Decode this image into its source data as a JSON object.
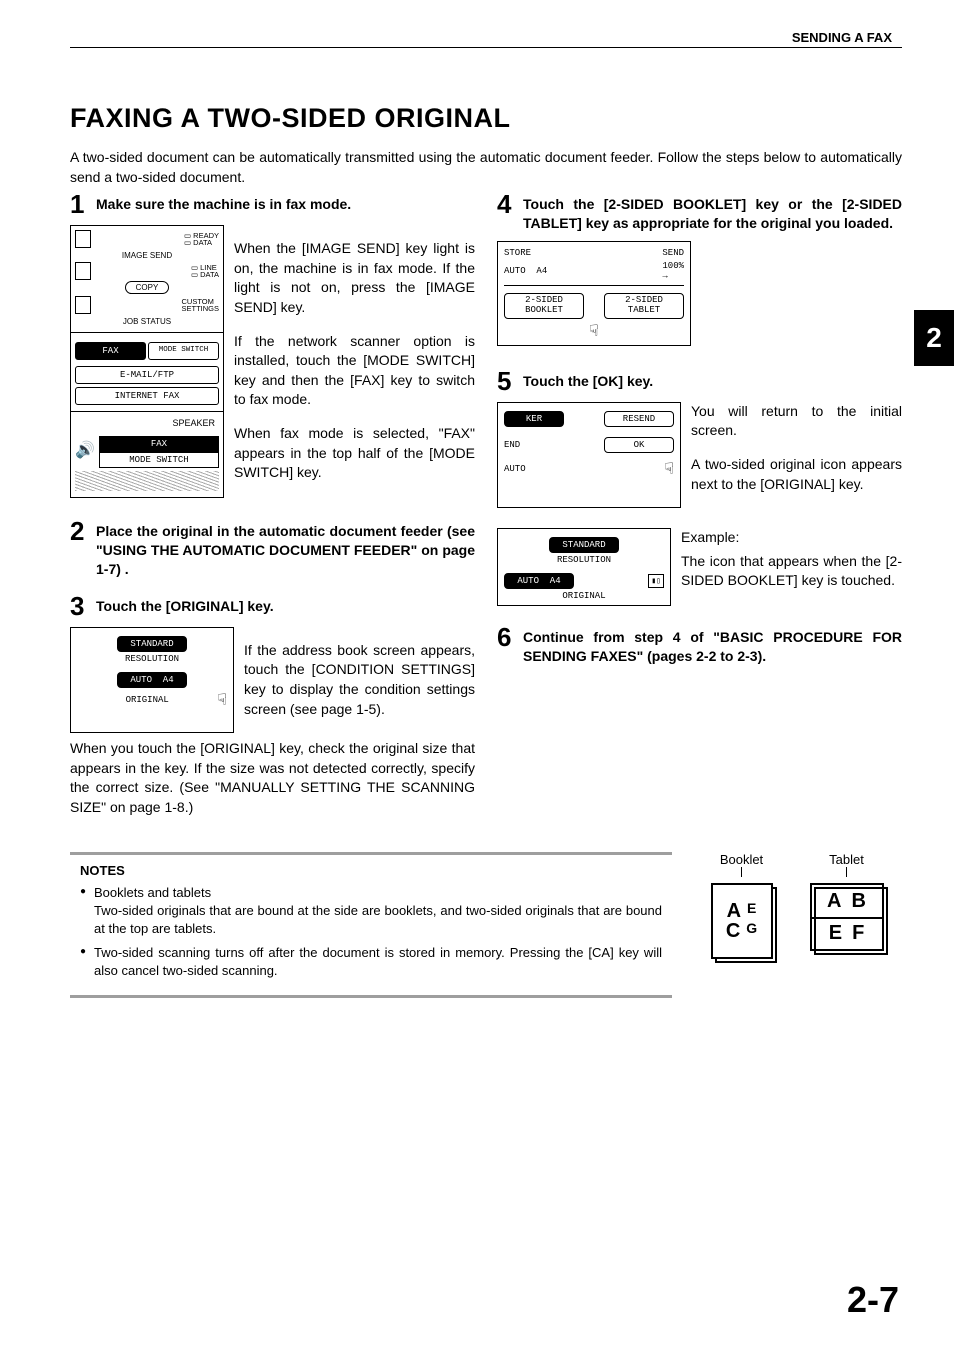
{
  "header": {
    "section": "SENDING A FAX"
  },
  "title": "FAXING A TWO-SIDED ORIGINAL",
  "intro": "A two-sided document can be automatically transmitted using the automatic document feeder. Follow the steps below to automatically send a two-sided document.",
  "chapter_tab": "2",
  "page_number": "2-7",
  "steps": {
    "s1": {
      "num": "1",
      "title": "Make sure the machine is in fax mode.",
      "p1": "When the [IMAGE SEND] key light is on, the machine is in fax mode. If the light is not on, press the [IMAGE SEND] key.",
      "p2": "If the network scanner option is installed, touch the [MODE SWITCH] key and then the [FAX] key to switch to fax mode.",
      "p3": "When fax mode is selected, \"FAX\" appears in the top half of the [MODE SWITCH] key."
    },
    "s2": {
      "num": "2",
      "title": "Place the original in the automatic document feeder (see \"USING THE AUTOMATIC DOCUMENT FEEDER\" on page 1-7) ."
    },
    "s3": {
      "num": "3",
      "title": "Touch the [ORIGINAL] key.",
      "p1": "If the address book screen appears, touch the [CONDITION SETTINGS] key to display the condition settings screen (see page 1-5).",
      "p2": "When you touch the [ORIGINAL] key, check the original size that appears in the key. If the size was not detected correctly, specify the correct size. (See \"MANUALLY SETTING THE SCANNING SIZE\" on page 1-8.)"
    },
    "s4": {
      "num": "4",
      "title": "Touch the [2-SIDED BOOKLET] key or the [2-SIDED TABLET] key as appropriate for the original you loaded."
    },
    "s5": {
      "num": "5",
      "title": "Touch the [OK] key.",
      "p1": "You will return to the initial screen.",
      "p2": "A two-sided original icon appears next to the [ORIGINAL] key.",
      "ex_label": "Example:",
      "ex_text": "The icon that appears when the [2-SIDED BOOKLET] key is touched."
    },
    "s6": {
      "num": "6",
      "title": "Continue from step 4 of \"BASIC PROCEDURE FOR SENDING FAXES\" (pages 2-2 to 2-3)."
    }
  },
  "panel": {
    "ready": "READY",
    "data1": "DATA",
    "image_send": "IMAGE SEND",
    "line": "LINE",
    "data2": "DATA",
    "copy": "COPY",
    "job_status": "JOB STATUS",
    "custom": "CUSTOM\nSETTINGS",
    "fax": "FAX",
    "mode_switch_btn": "MODE SWITCH",
    "email": "E-MAIL/FTP",
    "inet": "INTERNET FAX",
    "speaker": "SPEAKER",
    "fax2": "FAX",
    "mode_switch2": "MODE SWITCH"
  },
  "screen3": {
    "standard": "STANDARD",
    "resolution": "RESOLUTION",
    "auto": "AUTO",
    "a4": "A4",
    "original": "ORIGINAL"
  },
  "screen4": {
    "store": "STORE",
    "send": "SEND",
    "auto": "AUTO",
    "a4": "A4",
    "pct": "100%",
    "booklet": "2-SIDED\nBOOKLET",
    "tablet": "2-SIDED\nTABLET"
  },
  "screen5a": {
    "ker": "KER",
    "resend": "RESEND",
    "end": "END",
    "ok": "OK",
    "auto": "AUTO"
  },
  "screen5b": {
    "standard": "STANDARD",
    "resolution": "RESOLUTION",
    "auto": "AUTO",
    "a4": "A4",
    "original": "ORIGINAL"
  },
  "notes": {
    "heading": "NOTES",
    "n1_title": "Booklets and tablets",
    "n1_body": "Two-sided originals that are bound at the side are booklets, and two-sided originals that are bound at the top are tablets.",
    "n2": "Two-sided scanning turns off after the document is stored in memory. Pressing the [CA] key will also cancel two-sided scanning."
  },
  "bt": {
    "booklet": "Booklet",
    "tablet": "Tablet",
    "A": "A",
    "B": "B",
    "C": "C",
    "E": "E",
    "F": "F",
    "G": "G"
  }
}
